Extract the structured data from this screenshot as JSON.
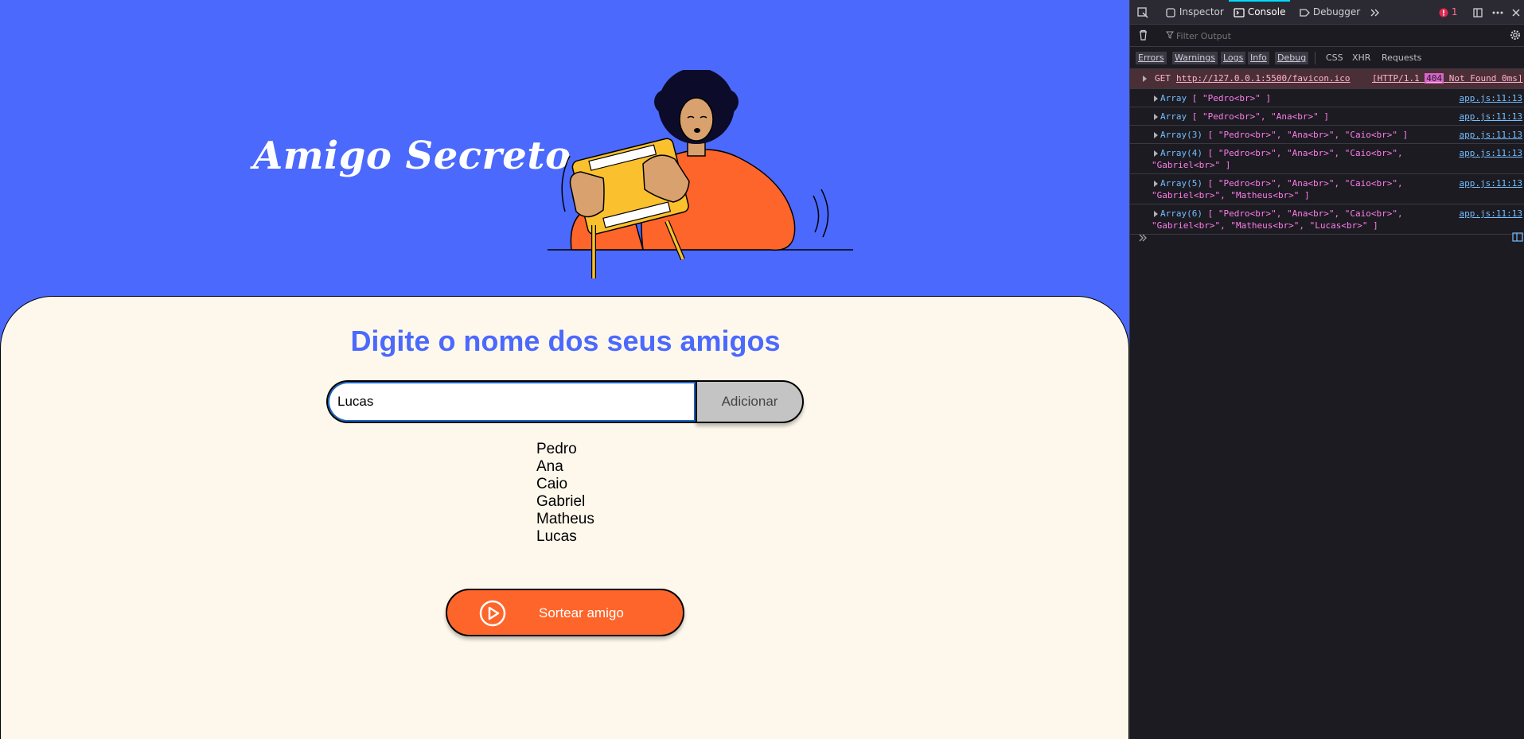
{
  "page": {
    "hero_title": "Amigo Secreto",
    "section_title": "Digite o nome dos seus amigos",
    "input_value": "Lucas",
    "add_button": "Adicionar",
    "friends": [
      "Pedro",
      "Ana",
      "Caio",
      "Gabriel",
      "Matheus",
      "Lucas"
    ],
    "draw_button": "Sortear amigo",
    "colors": {
      "hero_bg": "#4b69fd",
      "panel_bg": "#fef8ec",
      "accent": "#fe652b",
      "title": "#4b69fd"
    }
  },
  "devtools": {
    "tabs": {
      "inspector": "Inspector",
      "console": "Console",
      "debugger": "Debugger"
    },
    "error_count": "1",
    "filter_placeholder": "Filter Output",
    "levels": {
      "errors": "Errors",
      "warnings": "Warnings",
      "logs": "Logs",
      "info": "Info",
      "debug": "Debug",
      "css": "CSS",
      "xhr": "XHR",
      "requests": "Requests"
    },
    "error_row": {
      "method": "GET",
      "url": "http://127.0.0.1:5500/favicon.ico",
      "status_prefix": "[HTTP/1.1",
      "status_code": "404",
      "status_suffix": "Not Found 0ms]"
    },
    "log_source": "app.js:11:13",
    "logs": [
      {
        "label": "Array",
        "line1": "[ \"Pedro<br>\" ]",
        "line2": ""
      },
      {
        "label": "Array",
        "line1": "[ \"Pedro<br>\", \"Ana<br>\" ]",
        "line2": ""
      },
      {
        "label": "Array(3)",
        "line1": "[ \"Pedro<br>\", \"Ana<br>\", \"Caio<br>\" ]",
        "line2": ""
      },
      {
        "label": "Array(4)",
        "line1": "[ \"Pedro<br>\", \"Ana<br>\", \"Caio<br>\",",
        "line2": "\"Gabriel<br>\" ]"
      },
      {
        "label": "Array(5)",
        "line1": "[ \"Pedro<br>\", \"Ana<br>\", \"Caio<br>\",",
        "line2": "\"Gabriel<br>\", \"Matheus<br>\" ]"
      },
      {
        "label": "Array(6)",
        "line1": "[ \"Pedro<br>\", \"Ana<br>\", \"Caio<br>\",",
        "line2": "\"Gabriel<br>\", \"Matheus<br>\", \"Lucas<br>\" ]"
      }
    ]
  }
}
